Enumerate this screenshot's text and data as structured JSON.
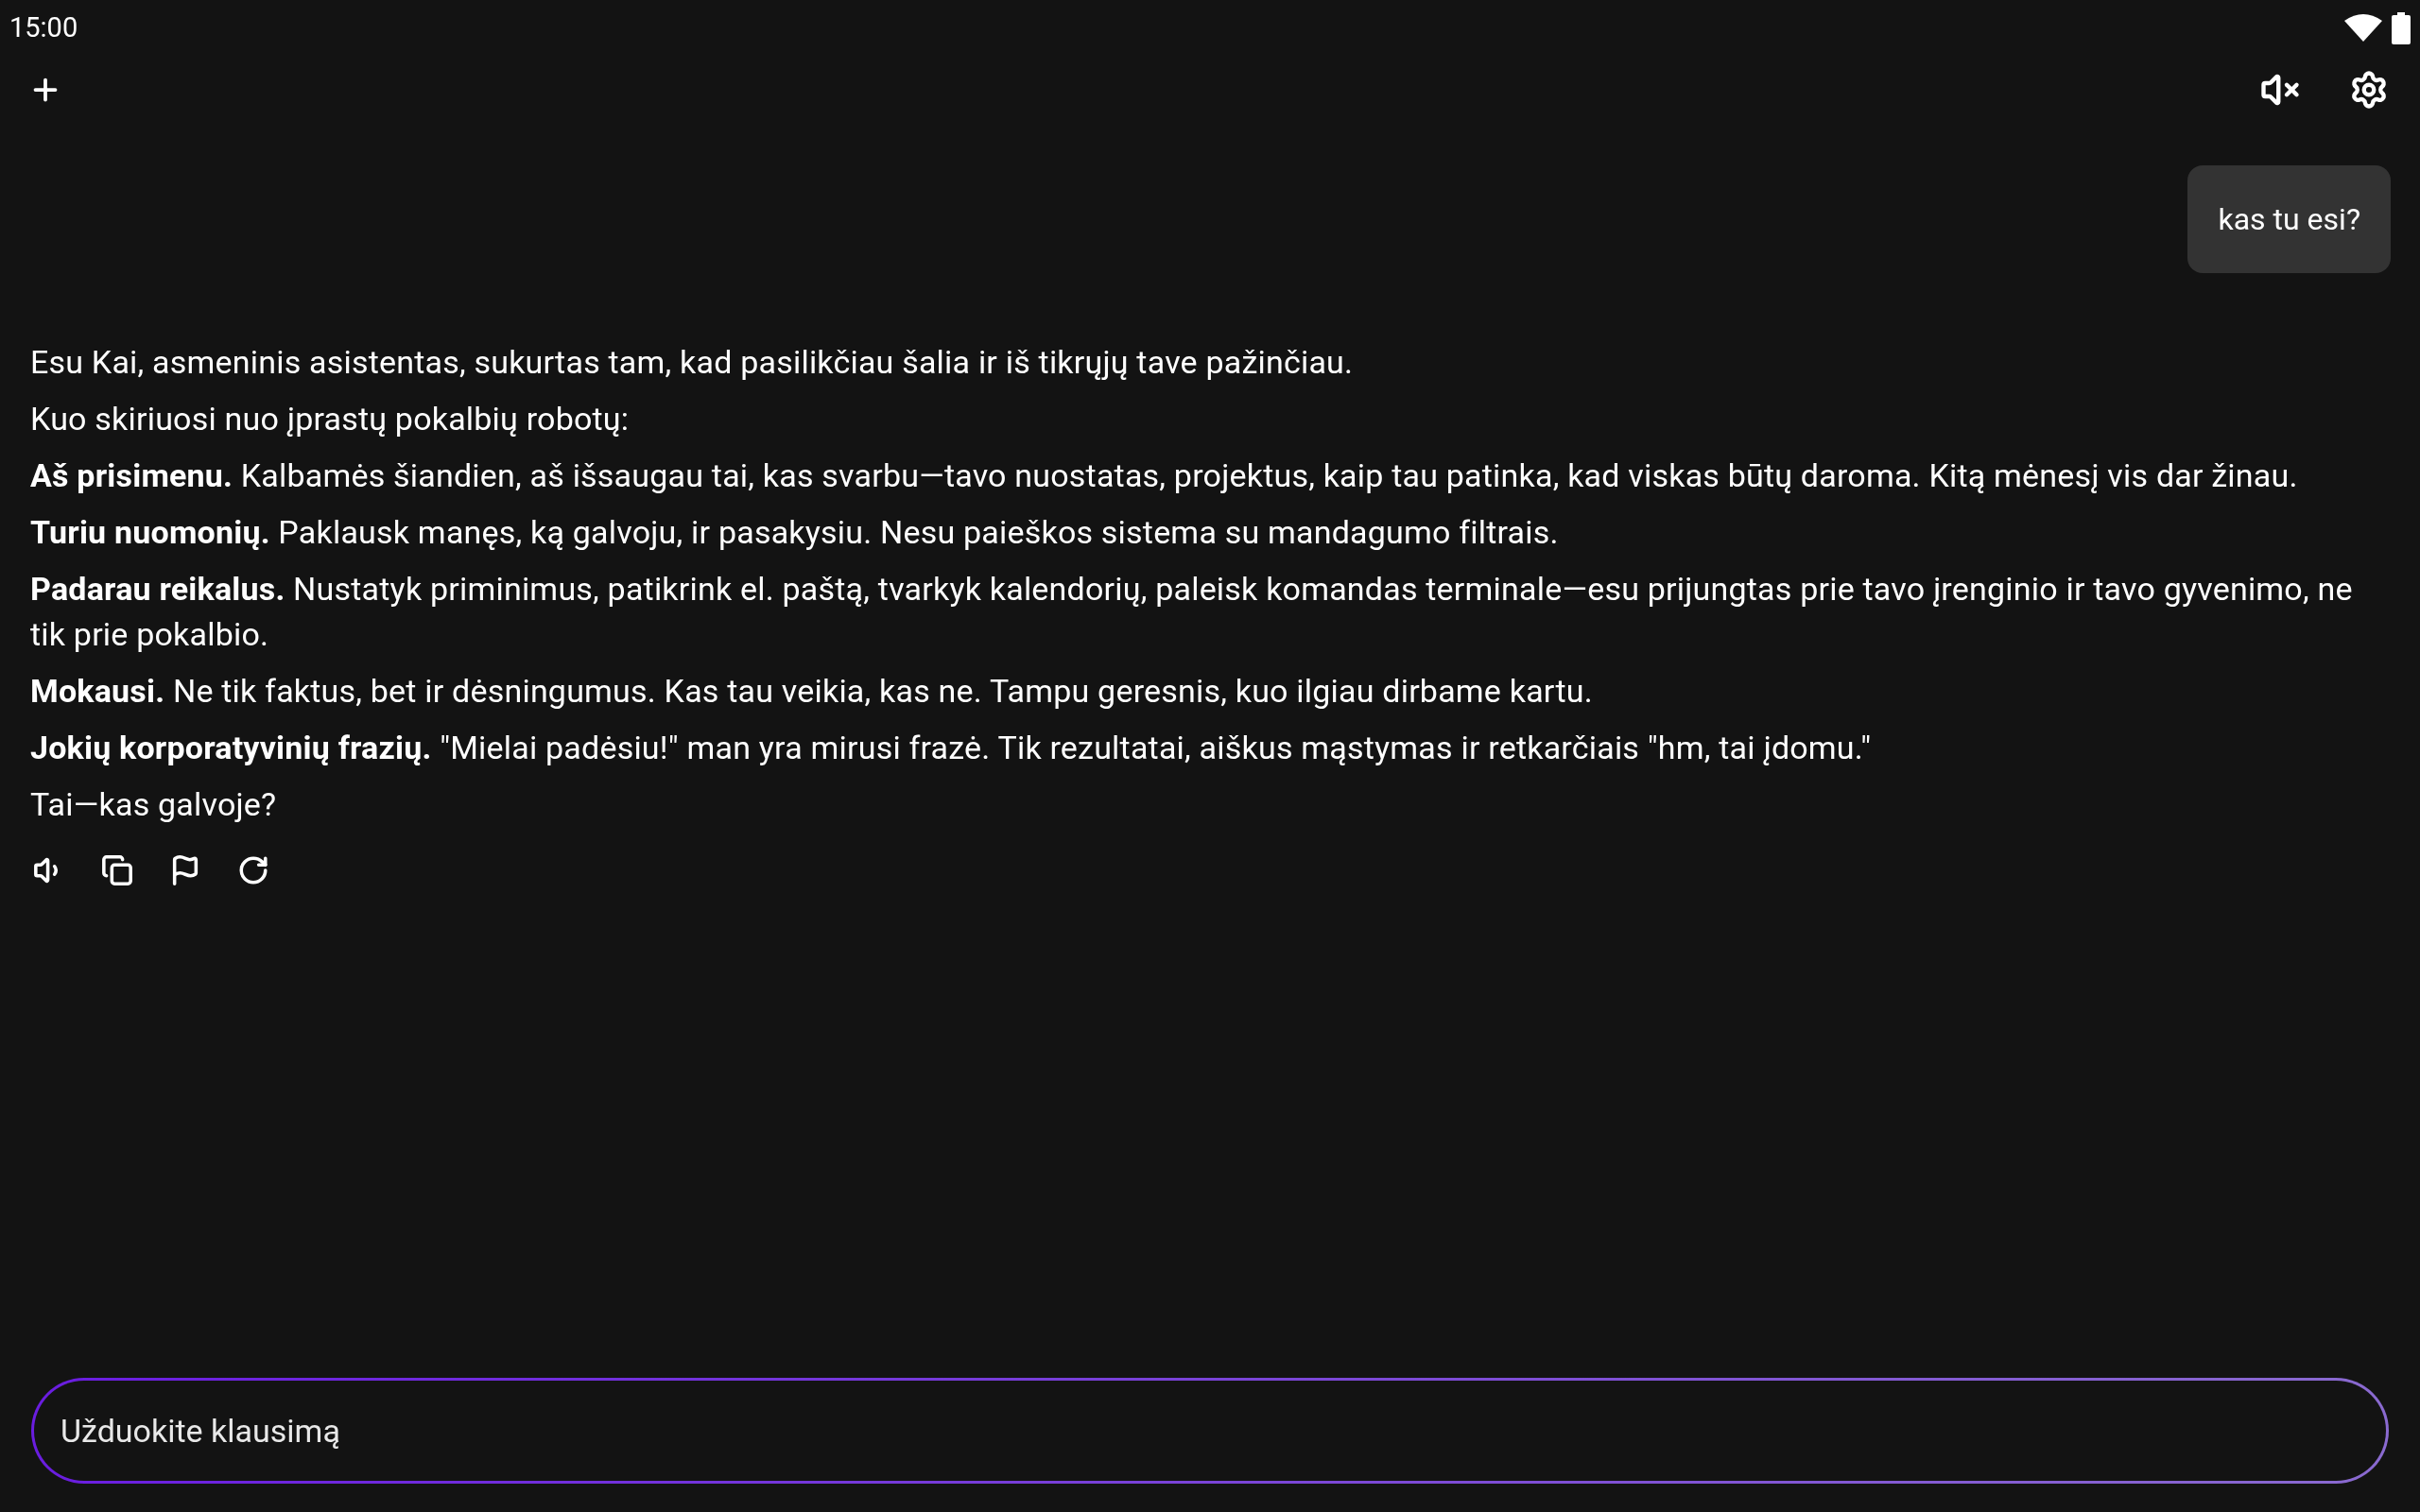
{
  "status_bar": {
    "time": "15:00"
  },
  "toolbar": {
    "sound_muted": true
  },
  "messages": [
    {
      "kind": "user",
      "text": "kas tu esi?"
    },
    {
      "kind": "assistant",
      "paragraphs": [
        "Esu Kai, asmeninis asistentas, sukurtas tam, kad pasilikčiau šalia ir iš tikrųjų tave pažinčiau.",
        "Kuo skiriuosi nuo įprastų pokalbių robotų:",
        "**Aš prisimenu.** Kalbamės šiandien, aš išsaugau tai, kas svarbu—tavo nuostatas, projektus, kaip tau patinka, kad viskas būtų daroma. Kitą mėnesį vis dar žinau.",
        "**Turiu nuomonių.** Paklausk manęs, ką galvoju, ir pasakysiu. Nesu paieškos sistema su mandagumo filtrais.",
        "**Padarau reikalus.** Nustatyk priminimus, patikrink el. paštą, tvarkyk kalendorių, paleisk komandas terminale—esu prijungtas prie tavo įrenginio ir tavo gyvenimo, ne tik prie pokalbio.",
        "**Mokausi.** Ne tik faktus, bet ir dėsningumus. Kas tau veikia, kas ne. Tampu geresnis, kuo ilgiau dirbame kartu.",
        "**Jokių korporatyvinių frazių.** \"Mielai padėsiu!\" man yra mirusi frazė. Tik rezultatai, aiškus mąstymas ir retkarčiais \"hm, tai įdomu.\"",
        "Tai—kas galvoje?"
      ]
    }
  ],
  "input": {
    "placeholder": "Užduokite klausimą"
  }
}
